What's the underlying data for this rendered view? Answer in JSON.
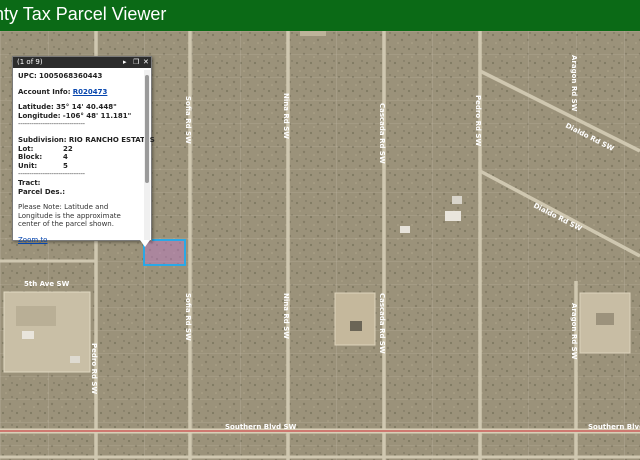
{
  "header": {
    "title": "nty Tax Parcel Viewer"
  },
  "map": {
    "roads": [
      "Southern Blvd SW",
      "Southern Blvd SW",
      "5th Ave SW",
      "Dialdo Rd SW",
      "Dialdo Rd SW",
      "Cascada Rd SW",
      "Cascada Rd SW",
      "Nina Rd SW",
      "Nina Rd SW",
      "Sofia Rd SW",
      "Sofia Rd SW",
      "Pedro Rd SW",
      "Pedro Rd SW",
      "Aragon Rd SW"
    ],
    "colors": {
      "highlight_border": "#29a8e6",
      "highlight_fill": "#c07fcc",
      "header_bg": "#0b6a16"
    }
  },
  "popup": {
    "count": "(1 of 9)",
    "btn_next": "▸",
    "btn_max": "❐",
    "btn_close": "✕",
    "upc_label": "UPC:",
    "upc_value": "1005068360443",
    "account_label": "Account Info:",
    "account_value": "R020473",
    "lat_label": "Latitude:",
    "lat_value": "35° 14' 40.448\"",
    "lon_label": "Longitude:",
    "lon_value": "-106° 48' 11.181\"",
    "sep1": "------------------------------",
    "subdivision_label": "Subdivision:",
    "subdivision_value": "RIO RANCHO ESTATES",
    "lot_label": "Lot:",
    "lot_value": "22",
    "block_label": "Block:",
    "block_value": "4",
    "unit_label": "Unit:",
    "unit_value": "5",
    "sep2": "------------------------------",
    "tract_label": "Tract:",
    "parcel_des_label": "Parcel Des.:",
    "note": "Please Note: Latitude and Longitude is the approximate center of the parcel shown.",
    "zoom": "Zoom to"
  }
}
